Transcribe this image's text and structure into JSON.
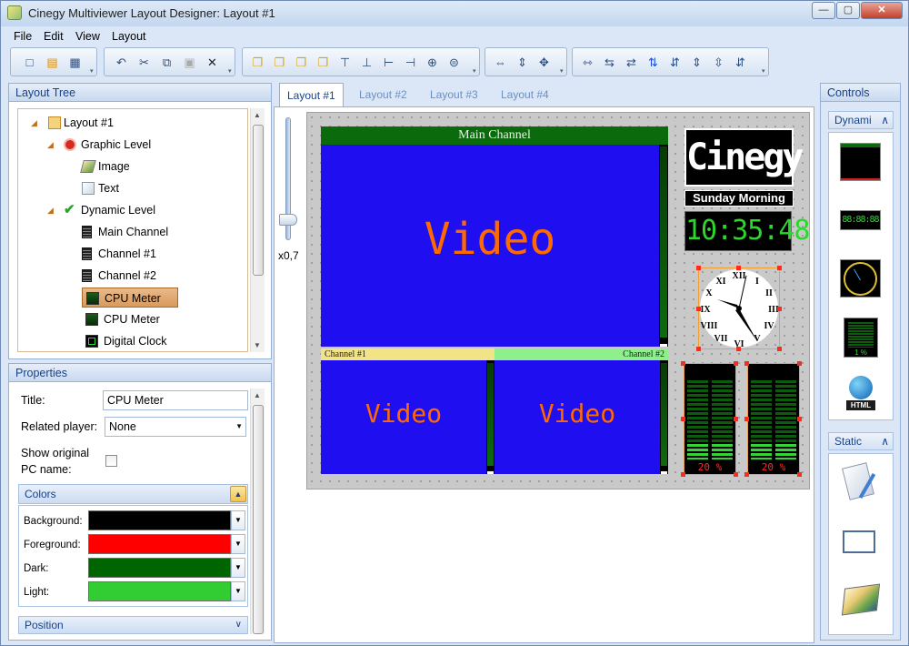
{
  "window": {
    "title": "Cinegy Multiviewer Layout Designer: Layout #1",
    "min": "—",
    "max": "▢",
    "close": "✕"
  },
  "menu": [
    "File",
    "Edit",
    "View",
    "Layout"
  ],
  "layout_tree": {
    "title": "Layout Tree",
    "items": [
      {
        "label": "Layout #1"
      },
      {
        "label": "Graphic Level"
      },
      {
        "label": "Image"
      },
      {
        "label": "Text"
      },
      {
        "label": "Dynamic Level"
      },
      {
        "label": "Main Channel"
      },
      {
        "label": "Channel #1"
      },
      {
        "label": "Channel #2"
      },
      {
        "label": "CPU Meter"
      },
      {
        "label": "CPU Meter"
      },
      {
        "label": "Digital Clock"
      }
    ]
  },
  "properties": {
    "title": "Properties",
    "title_label": "Title:",
    "title_value": "CPU Meter",
    "related_player_label": "Related player:",
    "related_player_value": "None",
    "show_pc_name_label_1": "Show original",
    "show_pc_name_label_2": "PC name:",
    "colors_group": "Colors",
    "colors": [
      {
        "label": "Background:",
        "hex": "#000000"
      },
      {
        "label": "Foreground:",
        "hex": "#ff0000"
      },
      {
        "label": "Dark:",
        "hex": "#006400"
      },
      {
        "label": "Light:",
        "hex": "#32cd32"
      }
    ],
    "position_group": "Position"
  },
  "tabs": [
    "Layout #1",
    "Layout #2",
    "Layout #3",
    "Layout #4"
  ],
  "zoom": "x0,7",
  "canvas": {
    "main_channel": "Main Channel",
    "video_label": "Video",
    "channel1": "Channel #1",
    "channel2": "Channel #2",
    "logo_text": "Cinegy",
    "caption": "Sunday Morning",
    "digital_time": "10:35:48",
    "meter1_pct": "20 %",
    "meter2_pct": "20 %",
    "meter_level_fraction": 0.2
  },
  "controls": {
    "title": "Controls",
    "dynamic_group": "Dynami",
    "static_group": "Static",
    "dynamic_items": [
      "channel-control",
      "digital-clock-control",
      "analog-clock-control",
      "cpu-meter-control",
      "html-control"
    ],
    "html_badge": "HTML",
    "cpu_badge": "1 %",
    "static_items": [
      "text-control",
      "rectangle-control",
      "image-control"
    ]
  }
}
